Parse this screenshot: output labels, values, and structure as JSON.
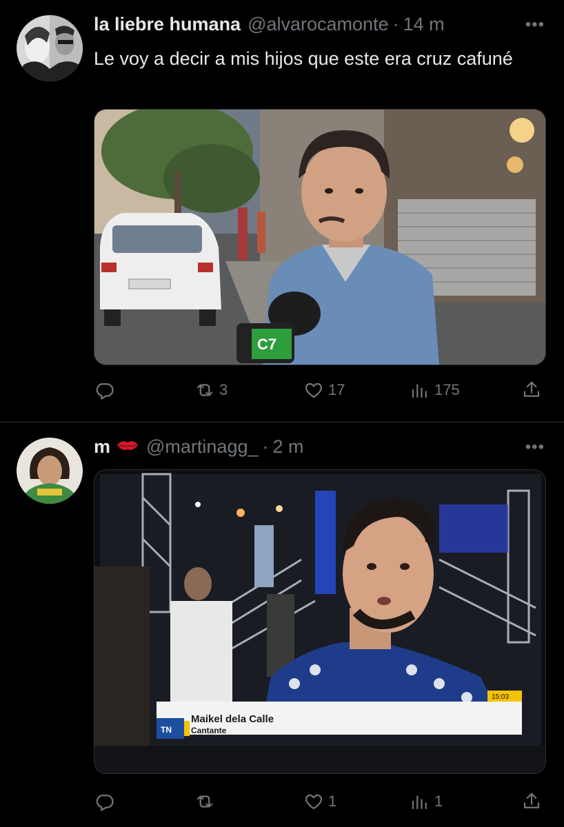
{
  "tweets": [
    {
      "display_name": "la liebre humana",
      "handle": "@alvarocamonte",
      "separator": "·",
      "time": "14 m",
      "more_label": "•••",
      "text": "Le voy a decir a mis hijos que este era cruz cafuné",
      "media_type": "video-frame",
      "stats": {
        "retweets": "3",
        "likes": "17",
        "views": "175"
      }
    },
    {
      "display_name": "m",
      "name_emoji": "kiss-mark-icon",
      "handle": "@martinagg_",
      "separator": "·",
      "time": "2 m",
      "more_label": "•••",
      "media_type": "tv-photo",
      "tv_caption": {
        "name": "Maikel dela Calle",
        "role": "Cantante",
        "channel": "TN",
        "clock": "15:03"
      },
      "stats": {
        "retweets": "",
        "likes": "1",
        "views": "1"
      }
    }
  ],
  "colors": {
    "background": "#000000",
    "text": "#e7e9ea",
    "muted": "#71767b",
    "divider": "#2f3336"
  }
}
